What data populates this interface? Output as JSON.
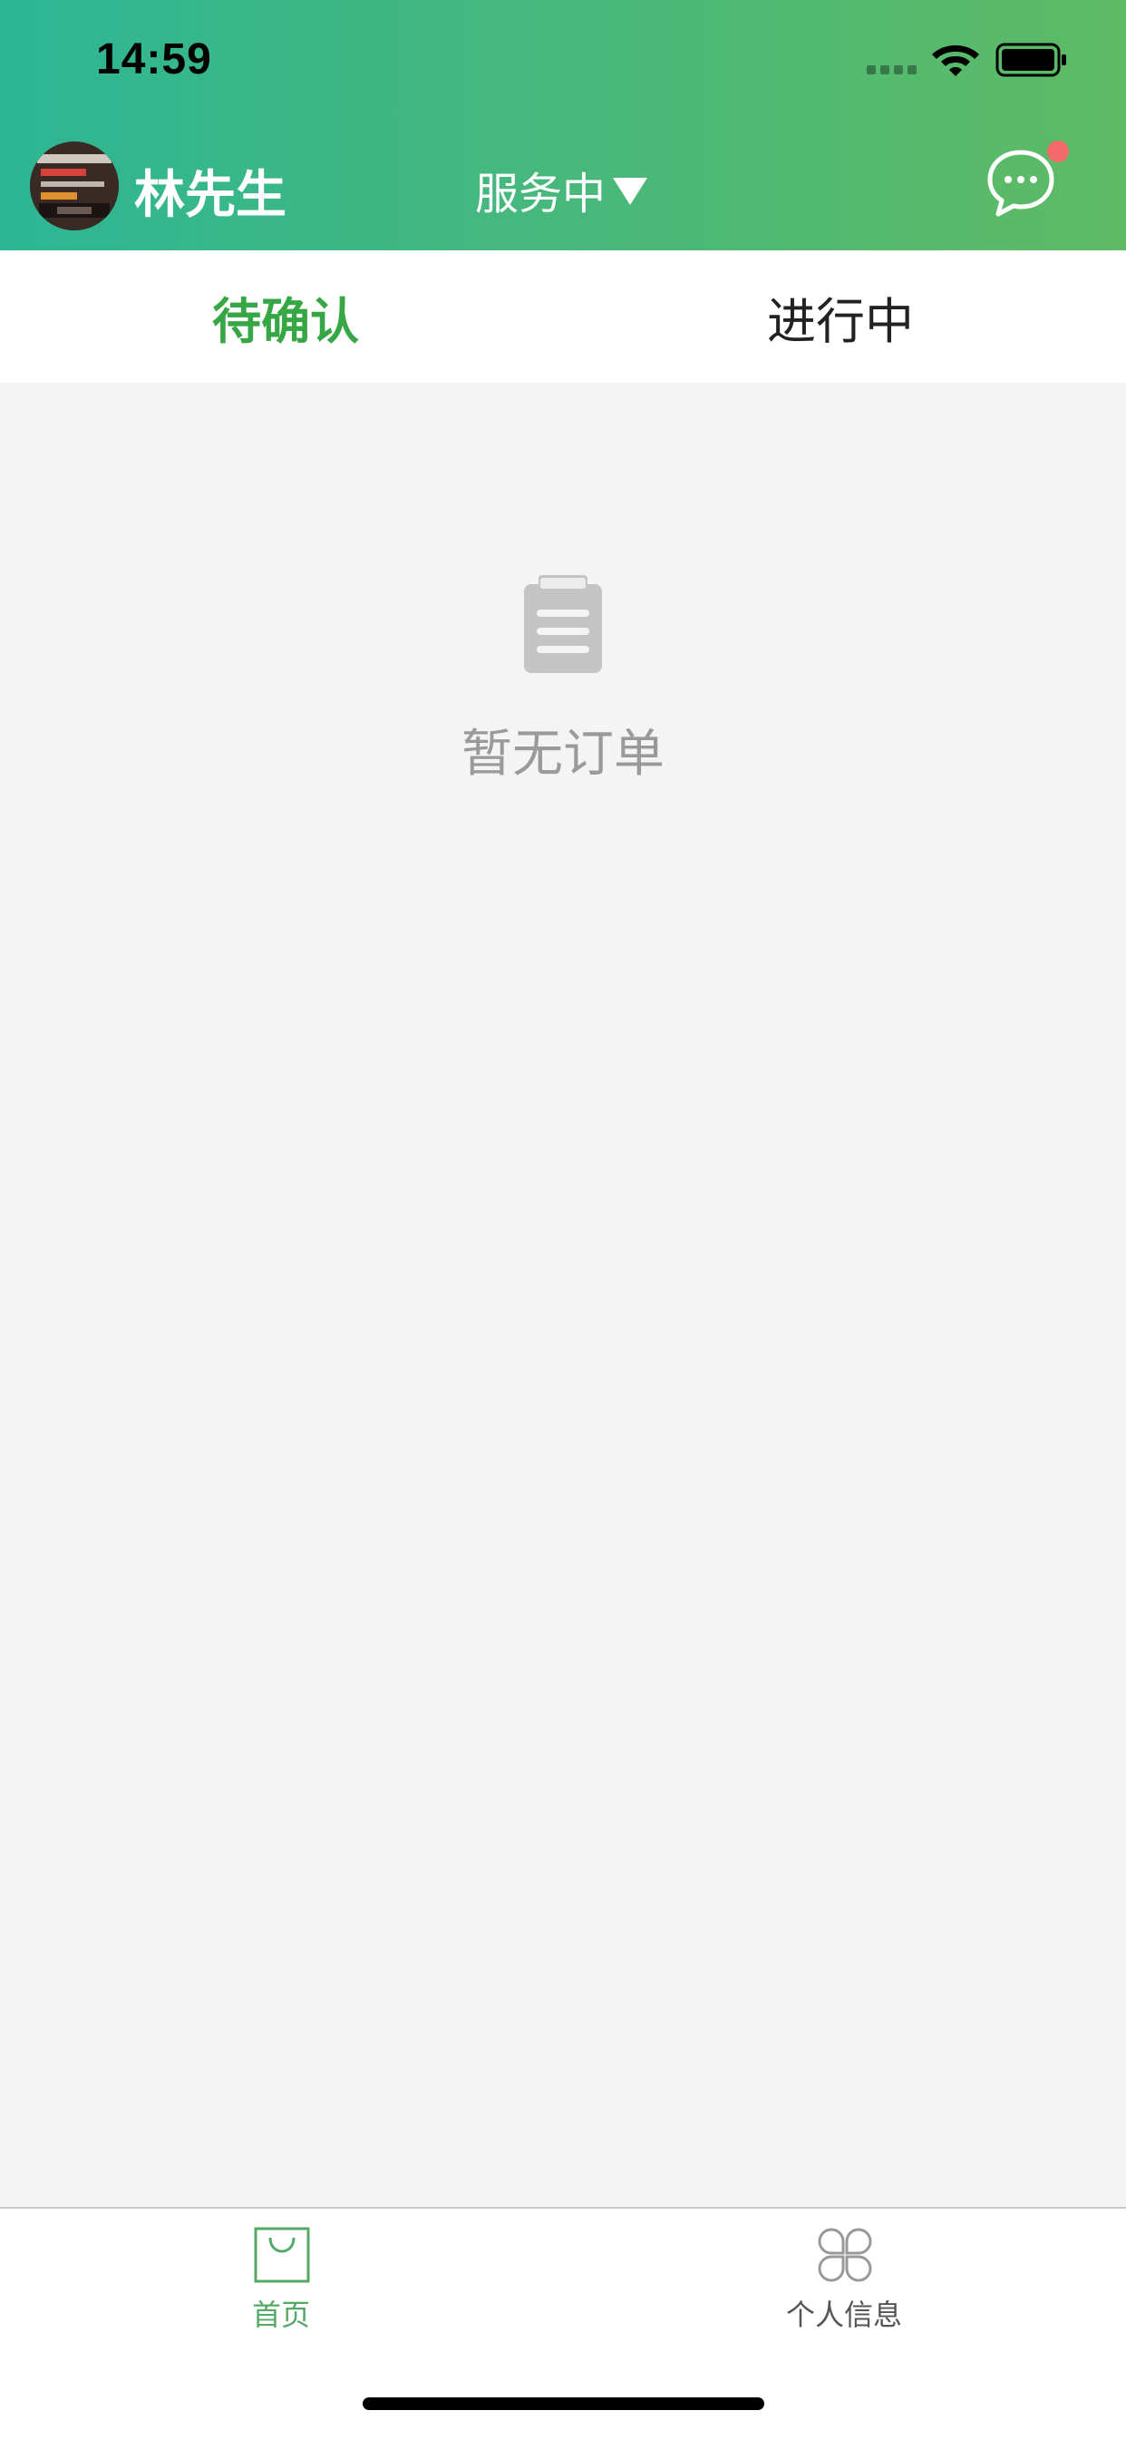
{
  "status_bar": {
    "time": "14:59",
    "wifi_icon": "wifi-icon",
    "battery_icon": "battery-icon"
  },
  "header": {
    "user_name": "林先生",
    "service_status": "服务中",
    "message_icon": "chat-bubble-icon",
    "has_notification": true,
    "notification_color": "#f56a6a"
  },
  "tabs": [
    {
      "label": "待确认",
      "active": true
    },
    {
      "label": "进行中",
      "active": false
    }
  ],
  "empty_state": {
    "icon": "clipboard-icon",
    "text": "暂无订单"
  },
  "bottom_nav": [
    {
      "label": "首页",
      "icon": "shopping-bag-icon",
      "active": true
    },
    {
      "label": "个人信息",
      "icon": "four-petal-icon",
      "active": false
    }
  ],
  "colors": {
    "header_gradient_start": "#2db694",
    "header_gradient_end": "#5ebb64",
    "accent_green": "#36a744",
    "nav_active_green": "#56a866",
    "background": "#f4f4f4"
  }
}
